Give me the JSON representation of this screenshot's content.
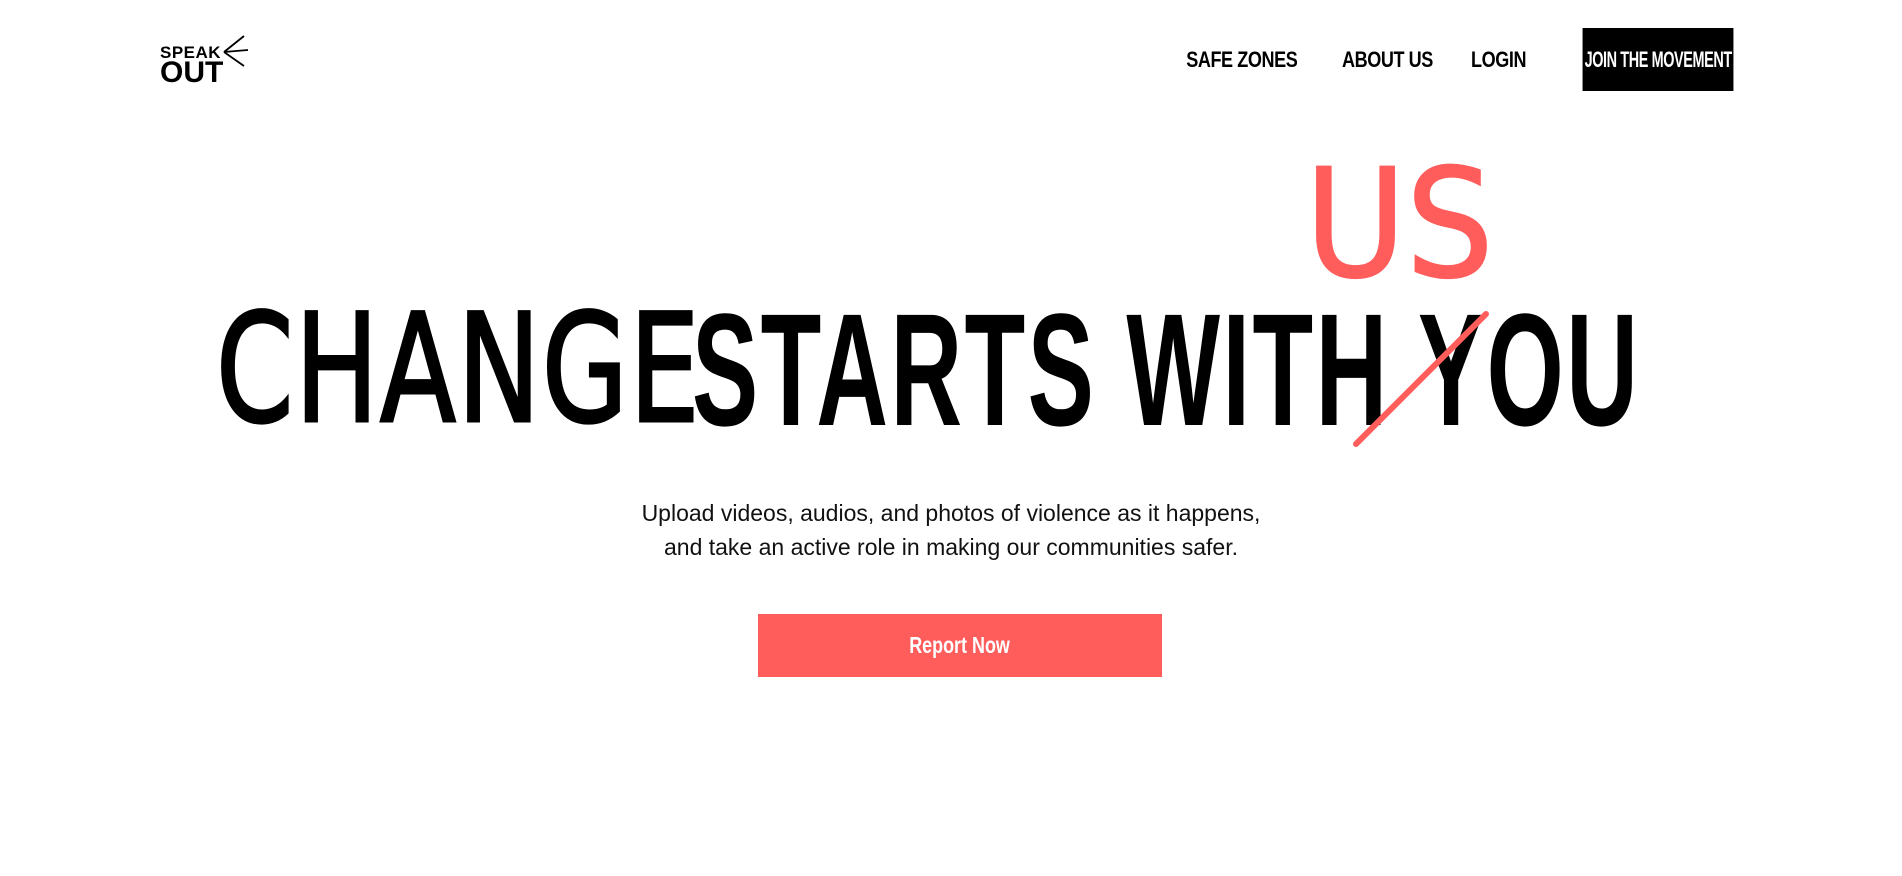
{
  "brand": {
    "logo_line1": "SPEAK",
    "logo_line2": "OUT"
  },
  "nav": {
    "items": [
      "SAFE ZONES",
      "ABOUT US",
      "LOGIN"
    ],
    "cta": "JOIN THE MOVEMENT"
  },
  "hero": {
    "word_handwritten": "CHANGE",
    "words_bold": "STARTS WITH YOU",
    "replacement": "US",
    "subtitle_line1": "Upload videos, audios, and photos of violence as it happens,",
    "subtitle_line2": "and take an active role in making our communities safer.",
    "cta": "Report Now"
  },
  "colors": {
    "accent": "#ff5c5c",
    "text": "#000000",
    "background": "#ffffff"
  }
}
